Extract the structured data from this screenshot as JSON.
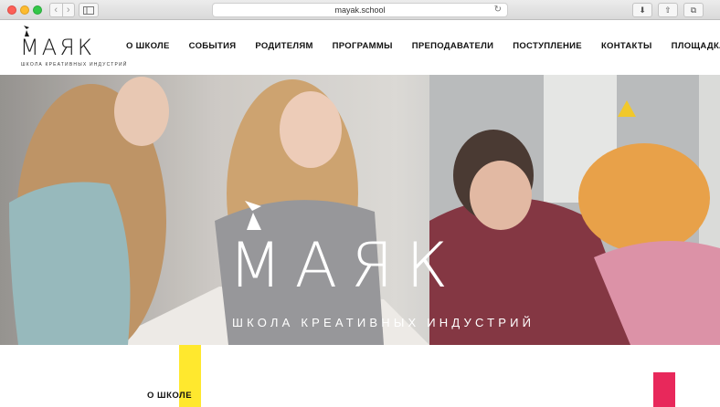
{
  "browser": {
    "url": "mayak.school",
    "back_icon": "‹",
    "forward_icon": "›",
    "reload_icon": "↻",
    "download_icon": "⬇",
    "share_icon": "⇧",
    "tabs_icon": "⧉",
    "new_tab_icon": "+"
  },
  "site": {
    "logo_word": "МАЯК",
    "logo_tagline": "ШКОЛА КРЕАТИВНЫХ ИНДУСТРИЙ",
    "nav": [
      {
        "label": "О ШКОЛЕ"
      },
      {
        "label": "СОБЫТИЯ"
      },
      {
        "label": "РОДИТЕЛЯМ"
      },
      {
        "label": "ПРОГРАММЫ"
      },
      {
        "label": "ПРЕПОДАВАТЕЛИ"
      },
      {
        "label": "ПОСТУПЛЕНИЕ"
      },
      {
        "label": "КОНТАКТЫ"
      },
      {
        "label": "ПЛОЩАДКА"
      }
    ]
  },
  "hero": {
    "title": "МАЯК",
    "subtitle": "ШКОЛА КРЕАТИВНЫХ ИНДУСТРИЙ"
  },
  "section": {
    "title": "О ШКОЛЕ"
  },
  "colors": {
    "accent_yellow": "#ffe82e",
    "accent_red": "#e8285b"
  }
}
